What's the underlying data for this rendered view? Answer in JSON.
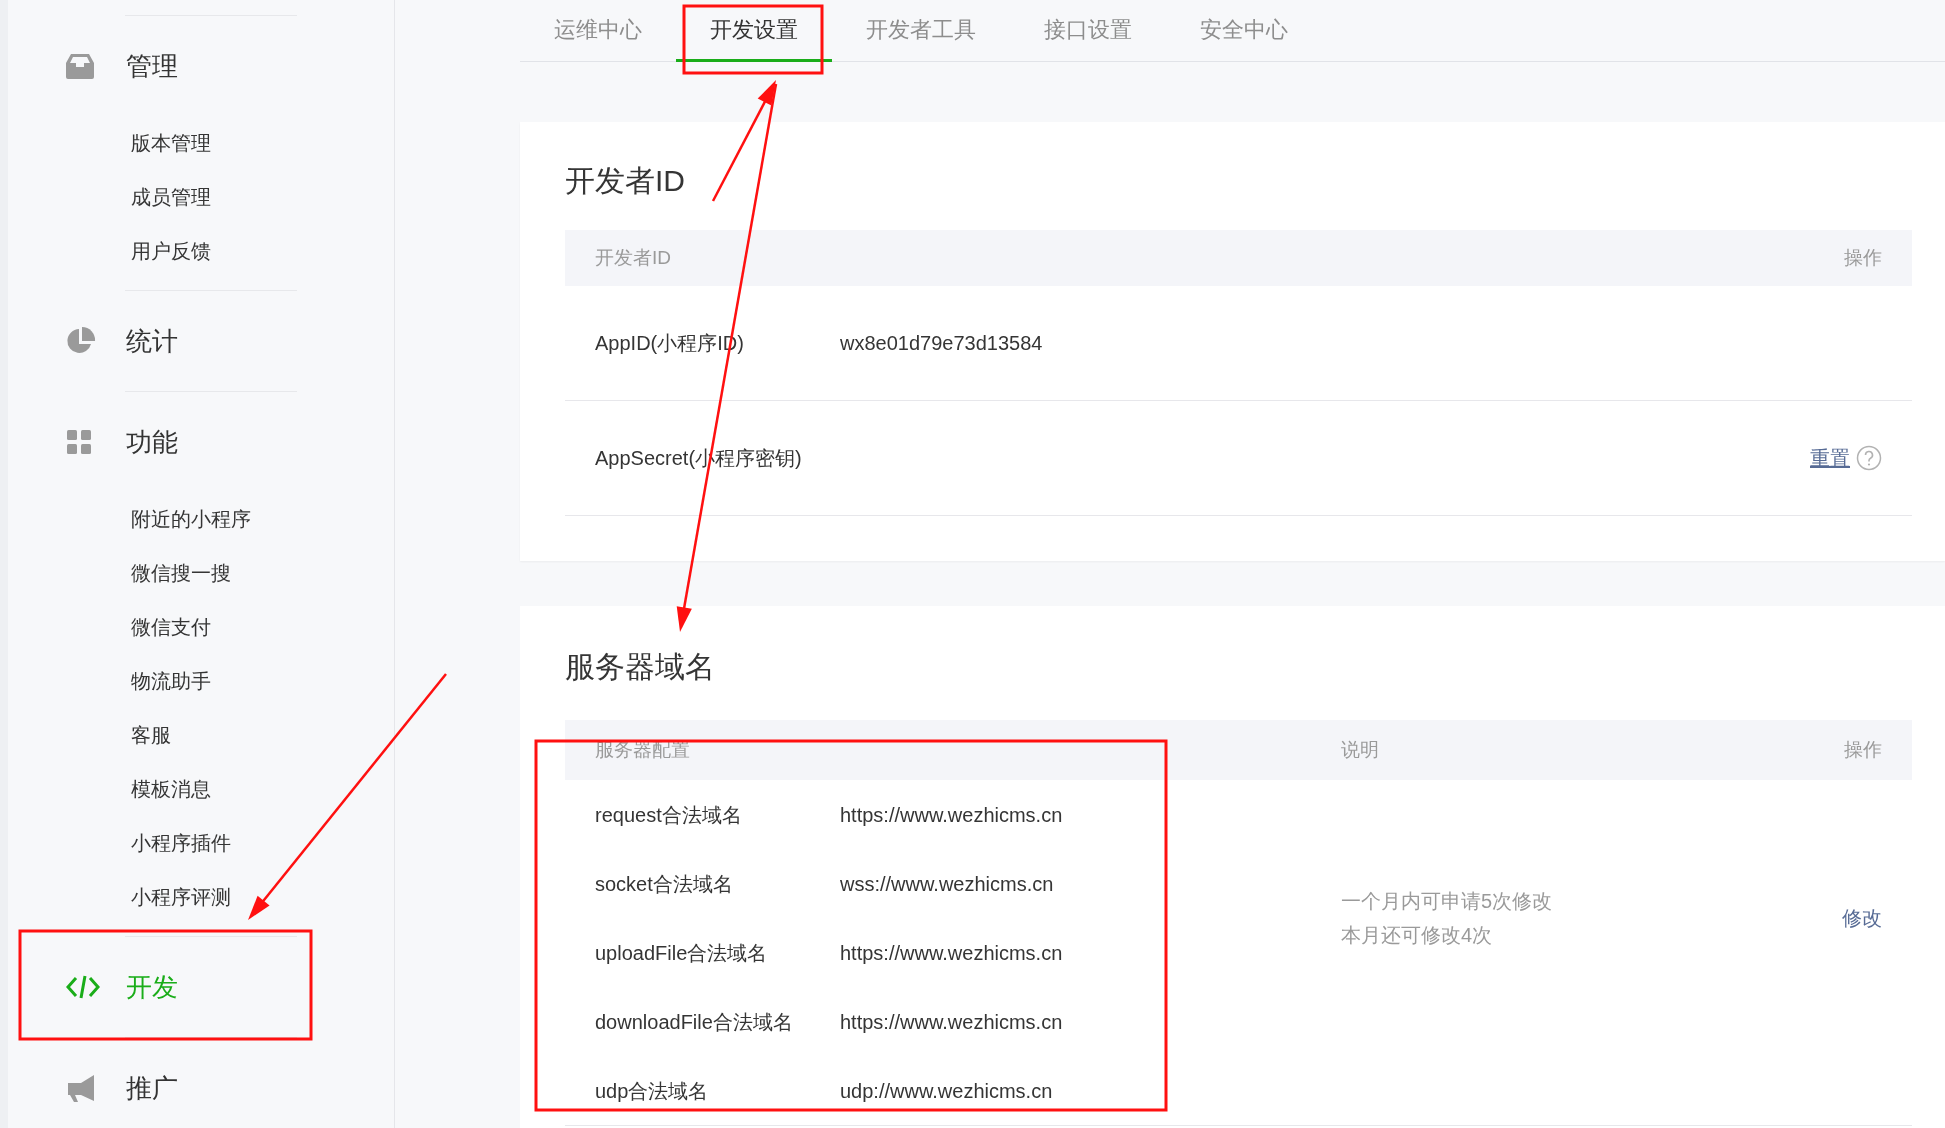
{
  "sidebar": {
    "groups": [
      {
        "kind": "inbox",
        "label": "管理",
        "selected": false,
        "items": [
          "版本管理",
          "成员管理",
          "用户反馈"
        ]
      },
      {
        "kind": "pie",
        "label": "统计",
        "selected": false
      },
      {
        "kind": "grid",
        "label": "功能",
        "selected": false,
        "items": [
          "附近的小程序",
          "微信搜一搜",
          "微信支付",
          "物流助手",
          "客服",
          "模板消息",
          "小程序插件",
          "小程序评测"
        ]
      },
      {
        "kind": "code",
        "label": "开发",
        "selected": true
      },
      {
        "kind": "megaphone",
        "label": "推广",
        "selected": false
      }
    ]
  },
  "tabs": [
    {
      "label": "运维中心",
      "selected": false
    },
    {
      "label": "开发设置",
      "selected": true
    },
    {
      "label": "开发者工具",
      "selected": false
    },
    {
      "label": "接口设置",
      "selected": false
    },
    {
      "label": "安全中心",
      "selected": false
    }
  ],
  "developer_id": {
    "title": "开发者ID",
    "columns": [
      "开发者ID",
      "操作"
    ],
    "rows": [
      {
        "name": "AppID(小程序ID)",
        "value": "wx8e01d79e73d13584"
      },
      {
        "name": "AppSecret(小程序密钥)",
        "action": "重置",
        "help": true
      }
    ]
  },
  "server_domains": {
    "title": "服务器域名",
    "columns": [
      "服务器配置",
      "说明",
      "操作"
    ],
    "rows": [
      {
        "name": "request合法域名",
        "value": "https://www.wezhicms.cn"
      },
      {
        "name": "socket合法域名",
        "value": "wss://www.wezhicms.cn"
      },
      {
        "name": "uploadFile合法域名",
        "value": "https://www.wezhicms.cn"
      },
      {
        "name": "downloadFile合法域名",
        "value": "https://www.wezhicms.cn"
      },
      {
        "name": "udp合法域名",
        "value": "udp://www.wezhicms.cn"
      }
    ],
    "note": [
      "一个月内可申请5次修改",
      "本月还可修改4次"
    ],
    "action": "修改"
  }
}
